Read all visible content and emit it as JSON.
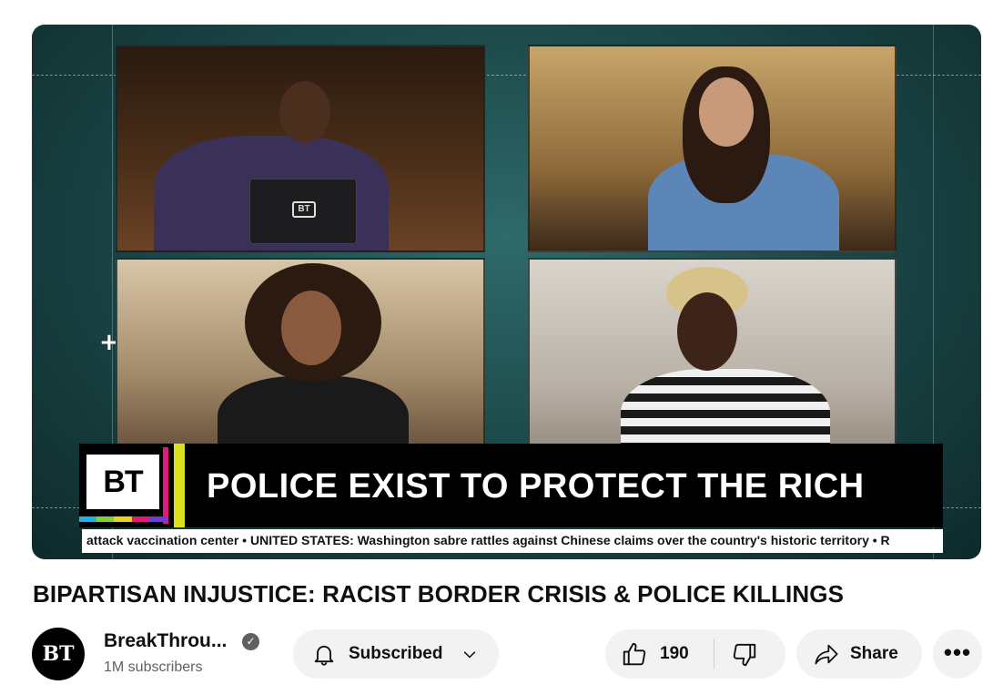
{
  "video": {
    "banner_logo": "BT",
    "headline": "POLICE EXIST TO PROTECT THE RICH",
    "ticker": "attack vaccination center • UNITED STATES: Washington sabre rattles against Chinese claims over the country's historic territory • R",
    "laptop_logo": "BT",
    "stripe_colors": [
      "#1fb3e5",
      "#7fd13a",
      "#e8d21c",
      "#e0197d",
      "#6a3fd1"
    ]
  },
  "title": "BIPARTISAN INJUSTICE: RACIST BORDER CRISIS & POLICE KILLINGS",
  "channel": {
    "avatar_text": "BT",
    "name": "BreakThrou...",
    "subscribers": "1M subscribers"
  },
  "actions": {
    "subscribe_label": "Subscribed",
    "like_count": "190",
    "share_label": "Share",
    "more_label": "•••"
  },
  "icons": {
    "bell": "bell-icon",
    "chevron": "chevron-down-icon",
    "like": "thumbs-up-icon",
    "dislike": "thumbs-down-icon",
    "share": "share-arrow-icon",
    "verified": "verified-check-icon"
  }
}
